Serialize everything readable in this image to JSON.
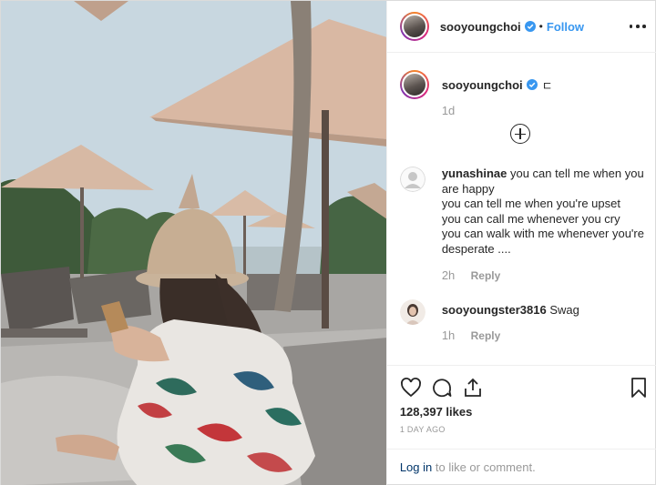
{
  "header": {
    "username": "sooyoungchoi",
    "separator": "•",
    "follow_label": "Follow",
    "more_icon": "more-horizontal-icon"
  },
  "caption": {
    "username": "sooyoungchoi",
    "text": "ㄷ",
    "time": "1d"
  },
  "comments": [
    {
      "username": "yunashinae",
      "lines": [
        "you can tell me when you are happy",
        "you can tell me when you're upset",
        "you can call me whenever you cry",
        "you can walk with me whenever you're desperate ...."
      ],
      "time": "2h",
      "reply_label": "Reply"
    },
    {
      "username": "sooyoungster3816",
      "text": "Swag",
      "time": "1h",
      "reply_label": "Reply"
    }
  ],
  "actions": {
    "likes": "128,397 likes",
    "posted_ago": "1 DAY AGO",
    "login_link": "Log in",
    "login_rest": " to like or comment."
  },
  "colors": {
    "accent": "#3897f0",
    "link_dark": "#003569",
    "muted": "#999999",
    "text": "#262626",
    "border": "#efefef"
  }
}
